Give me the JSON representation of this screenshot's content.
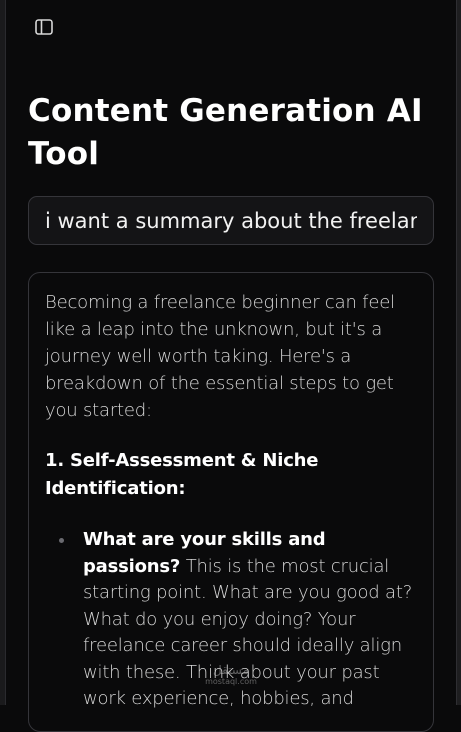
{
  "header": {
    "sidebar_toggle_icon": "sidebar-panel-icon",
    "title": "Content Generation AI Tool"
  },
  "prompt": {
    "value": "i want a summary about the freelance beginner"
  },
  "output": {
    "intro": "Becoming a freelance beginner can feel like a leap into the unknown, but it's a journey well worth taking. Here's a breakdown of the essential steps to get you started:",
    "section_heading": "1. Self-Assessment & Niche Identification:",
    "bullets": [
      {
        "strong": "What are your skills and passions?",
        "text": " This is the most crucial starting point. What are you good at? What do you enjoy doing? Your freelance career should ideally align with these. Think about your past work experience, hobbies, and"
      }
    ]
  },
  "watermark": {
    "main": "مستقل",
    "sub": "mostaql.com"
  },
  "colors": {
    "background": "#0a0a0b",
    "border": "#35353a",
    "text_primary": "#ffffff",
    "text_secondary": "#d6d6d6"
  }
}
